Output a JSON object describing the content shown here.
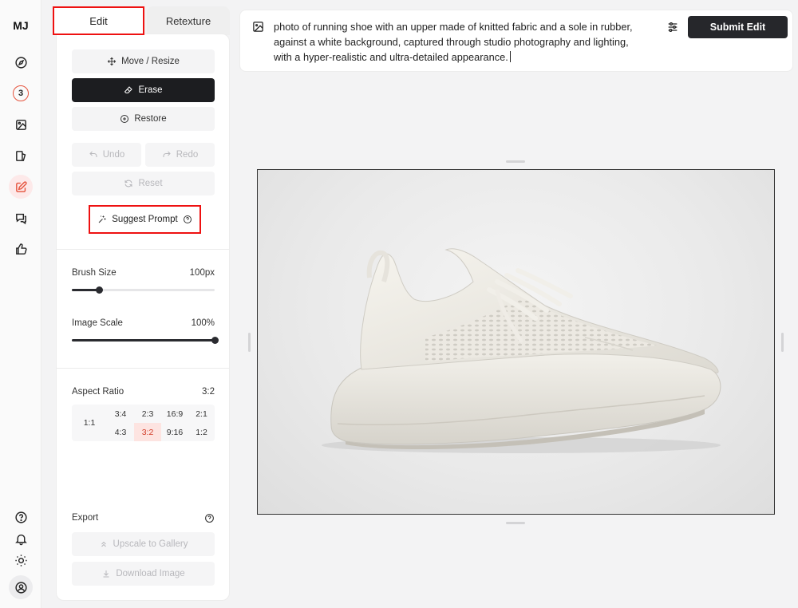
{
  "app": {
    "logo": "MJ"
  },
  "rail": {
    "badge_count": "3",
    "items": [
      "compass-icon",
      "badge-3",
      "image-icon",
      "gallery-icon",
      "edit-icon",
      "chat-icon",
      "thumbs-up-icon"
    ],
    "bottom_items": [
      "help-icon",
      "bell-icon",
      "sun-icon",
      "account-icon"
    ]
  },
  "tabs": {
    "edit": "Edit",
    "retexture": "Retexture"
  },
  "tools": {
    "move_resize": "Move / Resize",
    "erase": "Erase",
    "restore": "Restore",
    "undo": "Undo",
    "redo": "Redo",
    "reset": "Reset",
    "suggest_prompt": "Suggest Prompt"
  },
  "brush": {
    "label": "Brush Size",
    "value": "100px",
    "level": 0.19
  },
  "scale": {
    "label": "Image Scale",
    "value": "100%",
    "level": 1.0
  },
  "aspect": {
    "label": "Aspect Ratio",
    "value": "3:2",
    "square": "1:1",
    "row1": [
      "3:4",
      "2:3",
      "16:9",
      "2:1"
    ],
    "row2": [
      "4:3",
      "3:2",
      "9:16",
      "1:2"
    ],
    "selected": "3:2"
  },
  "export": {
    "label": "Export",
    "upscale": "Upscale to Gallery",
    "download": "Download Image"
  },
  "prompt": {
    "text": "photo of running shoe with an upper made of knitted fabric and a sole in rubber, against a white background, captured through studio photography and lighting, with a hyper-realistic and ultra-detailed appearance.",
    "submit": "Submit Edit"
  },
  "colors": {
    "accent": "#e5533d",
    "dark": "#1c1d20",
    "highlight": "#e11111"
  }
}
